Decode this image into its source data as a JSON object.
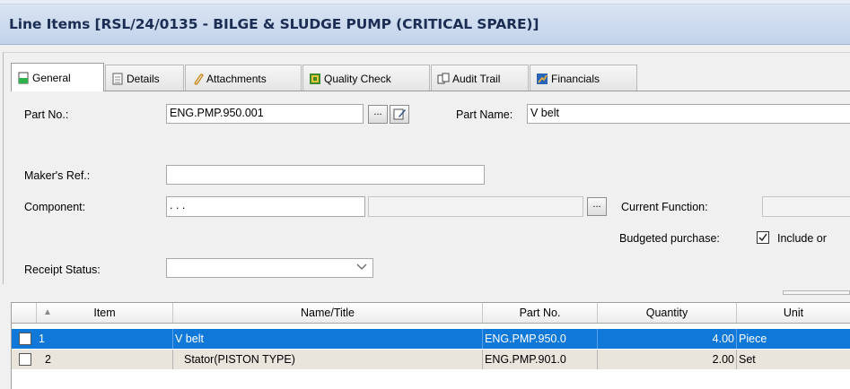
{
  "window": {
    "title": "Line Items [RSL/24/0135 - BILGE & SLUDGE PUMP (CRITICAL SPARE)]"
  },
  "tabs": [
    {
      "label": "General",
      "icon": "document-green-icon",
      "active": true
    },
    {
      "label": "Details",
      "icon": "document-icon",
      "active": false
    },
    {
      "label": "Attachments",
      "icon": "paperclip-icon",
      "active": false
    },
    {
      "label": "Quality Check",
      "icon": "quality-check-icon",
      "active": false
    },
    {
      "label": "Audit Trail",
      "icon": "audit-trail-icon",
      "active": false
    },
    {
      "label": "Financials",
      "icon": "financials-icon",
      "active": false
    }
  ],
  "form": {
    "part_no_label": "Part No.:",
    "part_no_value": "ENG.PMP.950.001",
    "ellipsis": "...",
    "part_name_label": "Part Name:",
    "part_name_value": "V belt",
    "makers_ref_label": "Maker's Ref.:",
    "makers_ref_value": "",
    "component_label": "Component:",
    "component_value": ". . .",
    "component_name_value": "",
    "current_function_label": "Current Function:",
    "current_function_value": "",
    "budgeted_label": "Budgeted purchase:",
    "budgeted_checked": true,
    "include_label": "Include or",
    "receipt_status_label": "Receipt Status:",
    "receipt_status_value": ""
  },
  "grid": {
    "columns": [
      "Item",
      "Name/Title",
      "Part No.",
      "Quantity",
      "Unit"
    ],
    "rows": [
      {
        "item": "1",
        "name": "V belt",
        "part_no": "ENG.PMP.950.0",
        "quantity": "4.00",
        "unit": "Piece",
        "selected": true
      },
      {
        "item": "2",
        "name": "Stator(PISTON TYPE)",
        "part_no": "ENG.PMP.901.0",
        "quantity": "2.00",
        "unit": "Set",
        "selected": false
      }
    ]
  },
  "colors": {
    "selection": "#0f78d8",
    "title_text": "#1b2d53",
    "title_bg": "#c9d8ee"
  }
}
